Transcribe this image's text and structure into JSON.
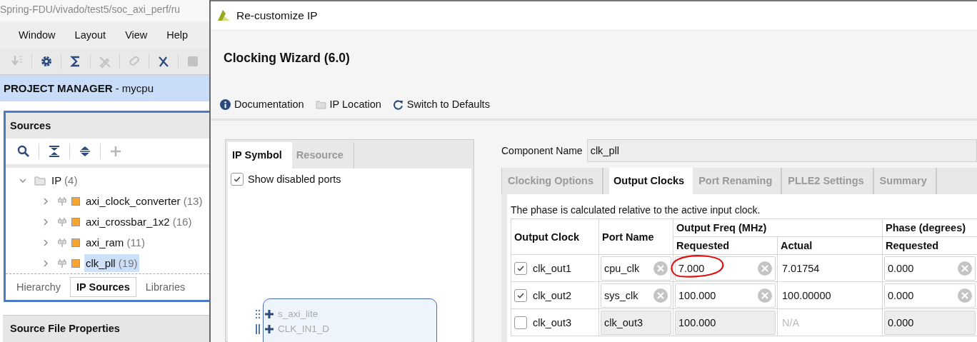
{
  "ide": {
    "path_title": "Spring-FDU/vivado/test5/soc_axi_perf/ru",
    "menu": [
      "Window",
      "Layout",
      "View",
      "Help"
    ],
    "toolbar": [
      {
        "disabled": true
      },
      {
        "disabled": false
      },
      {
        "disabled": false
      },
      {
        "disabled": true
      },
      {
        "disabled": true
      },
      {
        "disabled": false
      },
      {
        "disabled": true
      }
    ],
    "project_manager": "**PROJECT MANAGER** - mycpu",
    "sources": {
      "title": "Sources",
      "tools": [
        {
          "disabled": false
        },
        {
          "disabled": false
        },
        {
          "disabled": false
        },
        {
          "disabled": true
        }
      ],
      "tree": [
        {
          "label": "IP",
          "count": "(4)",
          "expanded": true,
          "selected": false,
          "children": [
            {
              "label": "axi_clock_converter",
              "count": "(13)",
              "expanded": false,
              "selected": false
            },
            {
              "label": "axi_crossbar_1x2",
              "count": "(16)",
              "expanded": false,
              "selected": false
            },
            {
              "label": "axi_ram",
              "count": "(11)",
              "expanded": false,
              "selected": false
            },
            {
              "label": "clk_pll",
              "count": "(19)",
              "expanded": false,
              "selected": true
            }
          ]
        }
      ],
      "tabs": [
        {
          "label": "Hierarchy",
          "selected": false
        },
        {
          "label": "IP Sources",
          "selected": true
        },
        {
          "label": "Libraries",
          "selected": false
        }
      ]
    },
    "properties_title": "Source File Properties"
  },
  "dialog": {
    "title": "Re-customize IP",
    "heading": "Clocking Wizard (6.0)",
    "links": [
      {
        "kind": "info",
        "label": "Documentation"
      },
      {
        "kind": "folder",
        "label": "IP Location"
      },
      {
        "kind": "reset",
        "label": "Switch to Defaults"
      }
    ],
    "symbol_tabs": [
      {
        "label": "IP Symbol",
        "selected": true
      },
      {
        "label": "Resource",
        "selected": false
      }
    ],
    "show_disabled_ports": {
      "label": "Show disabled ports",
      "checked": true
    },
    "ports": [
      {
        "kind": "bus",
        "name": "s_axi_lite"
      },
      {
        "kind": "pair",
        "name": "CLK_IN1_D"
      }
    ],
    "component_name": {
      "label": "Component Name",
      "value": "clk_pll"
    },
    "tabs": [
      {
        "label": "Clocking Options",
        "selected": false
      },
      {
        "label": "Output Clocks",
        "selected": true
      },
      {
        "label": "Port Renaming",
        "selected": false
      },
      {
        "label": "PLLE2 Settings",
        "selected": false
      },
      {
        "label": "Summary",
        "selected": false
      }
    ],
    "note": "The phase is calculated relative to the active input clock.",
    "table": {
      "headers": {
        "output_clock": "Output Clock",
        "port_name": "Port Name",
        "freq": "Output Freq (MHz)",
        "freq_requested": "Requested",
        "freq_actual": "Actual",
        "phase": "Phase (degrees)",
        "phase_requested": "Requested"
      },
      "rows": [
        {
          "checked": true,
          "name": "clk_out1",
          "port": "cpu_clk",
          "freq": "7.000",
          "circled": true,
          "actual": "7.01754",
          "phase": "0.000"
        },
        {
          "checked": true,
          "name": "clk_out2",
          "port": "sys_clk",
          "freq": "100.000",
          "circled": false,
          "actual": "100.00000",
          "phase": "0.000"
        },
        {
          "checked": false,
          "name": "clk_out3",
          "port": "clk_out3",
          "freq": "100.000",
          "circled": false,
          "actual": "N/A",
          "phase": "0.000"
        }
      ]
    }
  }
}
